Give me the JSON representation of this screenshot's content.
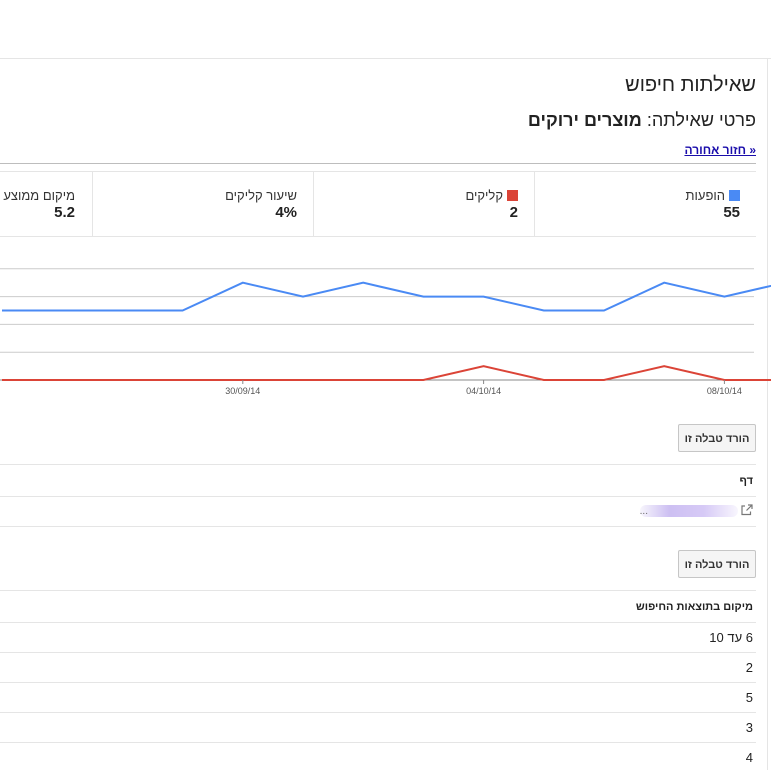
{
  "page": {
    "title": "שאילתות חיפוש",
    "subtitle_prefix": "פרטי שאילתה:",
    "query": "מוצרים ירוקים",
    "back_link": "« חזור אחורה"
  },
  "metrics": [
    {
      "label": "הופעות",
      "value": "55",
      "color": "#4a8af4"
    },
    {
      "label": "קליקים",
      "value": "2",
      "color": "#db4437"
    },
    {
      "label": "שיעור קליקים",
      "value": "4%"
    },
    {
      "label": "מיקום ממוצע",
      "value": "5.2"
    }
  ],
  "chart_data": {
    "type": "line",
    "x": [
      "26/09/14",
      "27/09/14",
      "28/09/14",
      "29/09/14",
      "30/09/14",
      "01/10/14",
      "02/10/14",
      "03/10/14",
      "04/10/14",
      "05/10/14",
      "06/10/14",
      "07/10/14",
      "08/10/14",
      "09/10/14",
      "10/10/14",
      "11/10/14",
      "12/10/14",
      "13/10/14",
      "14/10/14"
    ],
    "x_tick_labels": [
      "30/09/14",
      "04/10/14",
      "08/10/14"
    ],
    "series": [
      {
        "name": "הופעות",
        "color": "#4a8af4",
        "values": [
          5,
          5,
          5,
          5,
          7,
          6,
          7,
          6,
          6,
          5,
          5,
          7,
          6,
          7,
          9,
          6,
          5,
          5,
          5
        ]
      },
      {
        "name": "קליקים",
        "color": "#db4437",
        "values": [
          0,
          0,
          0,
          0,
          0,
          0,
          0,
          0,
          1,
          0,
          0,
          1,
          0,
          0,
          0,
          0,
          0,
          0,
          0
        ]
      }
    ],
    "ylim": [
      0,
      10
    ],
    "grid": true
  },
  "download_label": "הורד טבלה זו",
  "pages_table": {
    "header": "דף",
    "rows": [
      "..."
    ]
  },
  "positions_table": {
    "header": "מיקום בתוצאות החיפוש",
    "rows": [
      "6 עד 10",
      "2",
      "5",
      "3",
      "4"
    ]
  },
  "icons": {
    "external_link": "external-link-icon"
  }
}
